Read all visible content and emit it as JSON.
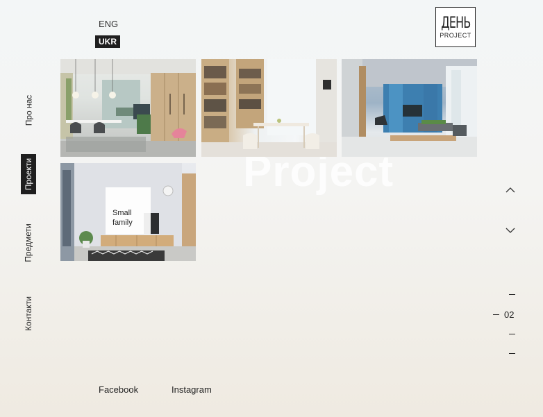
{
  "brand": {
    "logo_main": "ДЕНЬ",
    "logo_sub": "PROJECT",
    "watermark": "Project"
  },
  "languages": {
    "eng": "ENG",
    "ukr": "UKR",
    "active": "UKR"
  },
  "nav": {
    "items": [
      {
        "label": "Про нас",
        "active": false
      },
      {
        "label": "Проекти",
        "active": true
      },
      {
        "label": "Предмети",
        "active": false
      },
      {
        "label": "Контакти",
        "active": false
      }
    ]
  },
  "projects": {
    "hovered_caption": "Small family",
    "thumbnails": [
      {
        "name": "dining-room-photo"
      },
      {
        "name": "bookshelf-dining-photo"
      },
      {
        "name": "blue-living-room-photo"
      },
      {
        "name": "living-room-tv-wall-photo"
      }
    ]
  },
  "pager": {
    "current": "02"
  },
  "social": {
    "facebook": "Facebook",
    "instagram": "Instagram"
  },
  "icons": {
    "up": "chevron-up-icon",
    "down": "chevron-down-icon"
  },
  "colors": {
    "active_bg": "#1f1f1f",
    "text": "#222222"
  }
}
